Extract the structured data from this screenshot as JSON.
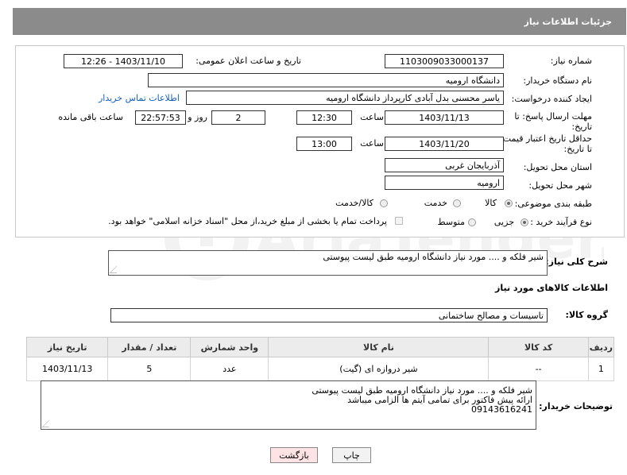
{
  "header": {
    "title": "جزئیات اطلاعات نیاز"
  },
  "form": {
    "need_number_label": "شماره نیاز:",
    "need_number": "1103009033000137",
    "announce_label": "تاریخ و ساعت اعلان عمومی:",
    "announce_value": "1403/11/10 - 12:26",
    "buyer_org_label": "نام دستگاه خریدار:",
    "buyer_org": "دانشگاه ارومیه",
    "requester_label": "ایجاد کننده درخواست:",
    "requester": "یاسر محسنی بدل آبادی کارپرداز دانشگاه ارومیه",
    "contact_link": "اطلاعات تماس خریدار",
    "deadline_label": "مهلت ارسال پاسخ: تا تاریخ:",
    "deadline_date": "1403/11/13",
    "time_label": "ساعت",
    "deadline_time": "12:30",
    "days_value": "2",
    "days_label": "روز و",
    "remaining_time": "22:57:53",
    "remaining_label": "ساعت باقی مانده",
    "validity_label": "حداقل تاریخ اعتبار قیمت: تا تاریخ:",
    "validity_date": "1403/11/20",
    "validity_time": "13:00",
    "province_label": "استان محل تحویل:",
    "province": "آذربایجان غربی",
    "city_label": "شهر محل تحویل:",
    "city": "ارومیه",
    "category_label": "طبقه بندی موضوعی:",
    "category_options": [
      "کالا",
      "خدمت",
      "کالا/خدمت"
    ],
    "process_label": "نوع فرآیند خرید :",
    "process_options": [
      "جزیی",
      "متوسط"
    ],
    "payment_note": "پرداخت تمام یا بخشی از مبلغ خرید،از محل \"اسناد خزانه اسلامی\" خواهد بود."
  },
  "summary": {
    "label": "شرح کلی نیاز:",
    "text": "شیر فلکه و .... مورد نیاز دانشگاه ارومیه طبق لیست پیوستی"
  },
  "goods_section_title": "اطلاعات کالاهای مورد نیاز",
  "goods_group": {
    "label": "گروه کالا:",
    "value": "تاسیسات و مصالح ساختمانی"
  },
  "table": {
    "headers": [
      "ردیف",
      "کد کالا",
      "نام کالا",
      "واحد شمارش",
      "تعداد / مقدار",
      "تاریخ نیاز"
    ],
    "rows": [
      [
        "1",
        "--",
        "شیر دروازه ای (گیت)",
        "عدد",
        "5",
        "1403/11/13"
      ]
    ]
  },
  "buyer_notes": {
    "label": "توضیحات خریدار:",
    "lines": [
      "شیر فلکه و .... مورد نیاز دانشگاه ارومیه طبق لیست پیوستی",
      "ارائه پیش فاکتور برای تمامی آیتم ها الزامی میباشد",
      "09143616241"
    ]
  },
  "buttons": {
    "print": "چاپ",
    "back": "بازگشت"
  },
  "colors": {
    "header_bg": "#8b8b8b",
    "link": "#1560bd",
    "back_button_bg": "#fde3e3"
  }
}
